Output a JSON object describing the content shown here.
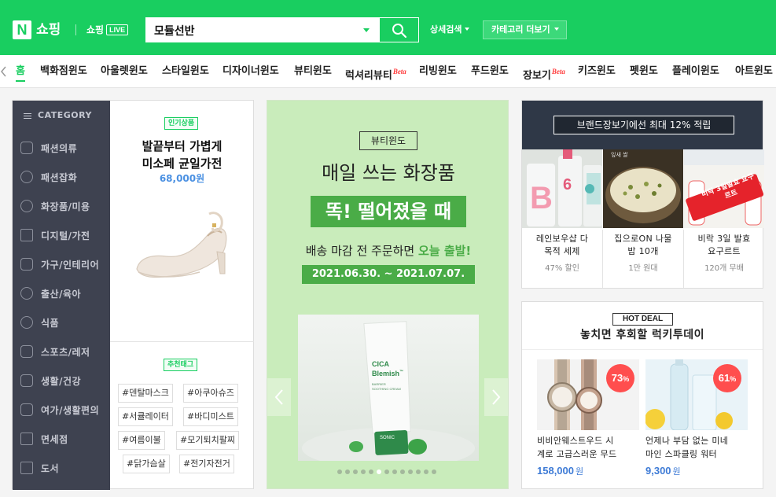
{
  "header": {
    "logo_mark": "N",
    "logo_text": "쇼핑",
    "live_text": "쇼핑",
    "live_badge": "LIVE",
    "search_value": "모듈선반",
    "advanced_search": "상세검색",
    "category_more": "카테고리 더보기",
    "brand_color": "#19ce60"
  },
  "nav": {
    "items": [
      {
        "label": "홈",
        "active": true
      },
      {
        "label": "백화점윈도"
      },
      {
        "label": "아울렛윈도"
      },
      {
        "label": "스타일윈도"
      },
      {
        "label": "디자이너윈도"
      },
      {
        "label": "뷰티윈도"
      },
      {
        "label": "럭셔리뷰티",
        "badge": "Beta"
      },
      {
        "label": "리빙윈도"
      },
      {
        "label": "푸드윈도"
      },
      {
        "label": "장보기",
        "badge": "Beta"
      },
      {
        "label": "키즈윈도"
      },
      {
        "label": "펫윈도"
      },
      {
        "label": "플레이윈도"
      },
      {
        "label": "아트윈도"
      }
    ]
  },
  "category": {
    "heading": "CATEGORY",
    "items": [
      "패션의류",
      "패션잡화",
      "화장품/미용",
      "디지털/가전",
      "가구/인테리어",
      "출산/육아",
      "식품",
      "스포츠/레저",
      "생활/건강",
      "여가/생활편의",
      "면세점",
      "도서"
    ]
  },
  "featured_product": {
    "tag": "인기상품",
    "title_line1": "발끝부터 가볍게",
    "title_line2": "미소페 균일가전",
    "price": "68,000원"
  },
  "recommended_tags": {
    "heading": "추천태그",
    "tags": [
      "#덴탈마스크",
      "#아쿠아슈즈",
      "#서큘레이터",
      "#바디미스트",
      "#여름이불",
      "#모기퇴치팔찌",
      "#닭가슴살",
      "#전기자전거"
    ]
  },
  "banner": {
    "label": "뷰티윈도",
    "title1": "매일 쓰는 화장품",
    "title2": "똑! 떨어졌을 때",
    "sub_prefix": "배송 마감 전 주문하면 ",
    "sub_highlight": "오늘 출발!",
    "date": "2021.06.30. ~ 2021.07.07.",
    "product_brand": "CICA",
    "product_name": "Blemish",
    "product_tm": "™",
    "product_desc1": "BARRIER",
    "product_desc2": "SOOTHING CREAM",
    "product_cap": "SONIC",
    "dots_total": 13,
    "active_dot": 5,
    "accent": "#4aac47"
  },
  "brand_sale": {
    "heading": "브랜드장보기에선 최대 12% 적립",
    "items": [
      {
        "name_line1": "레인보우샵 다",
        "name_line2": "목적 세제",
        "sub": "47% 할인"
      },
      {
        "name_line1": "집으로ON 나물",
        "name_line2": "밥 10개",
        "sub": "1만 원대"
      },
      {
        "name_line1": "비락 3일 발효",
        "name_line2": "요구르트",
        "sub": "120개 무배"
      }
    ],
    "image_texts": [
      "비락 3일발효 요구르트",
      "잎새 쌀",
      "6"
    ]
  },
  "hot_deal": {
    "badge": "HOT DEAL",
    "title": "놓치면 후회할 럭키투데이",
    "items": [
      {
        "discount": "73",
        "unit": "%",
        "name_line1": "비비안웨스트우드 시",
        "name_line2": "계로 고급스러운 무드",
        "price": "158,000",
        "won": "원"
      },
      {
        "discount": "61",
        "unit": "%",
        "name_line1": "언제나 부담 없는 미네",
        "name_line2": "마인 스파클링 워터",
        "price": "9,300",
        "won": "원"
      }
    ]
  }
}
